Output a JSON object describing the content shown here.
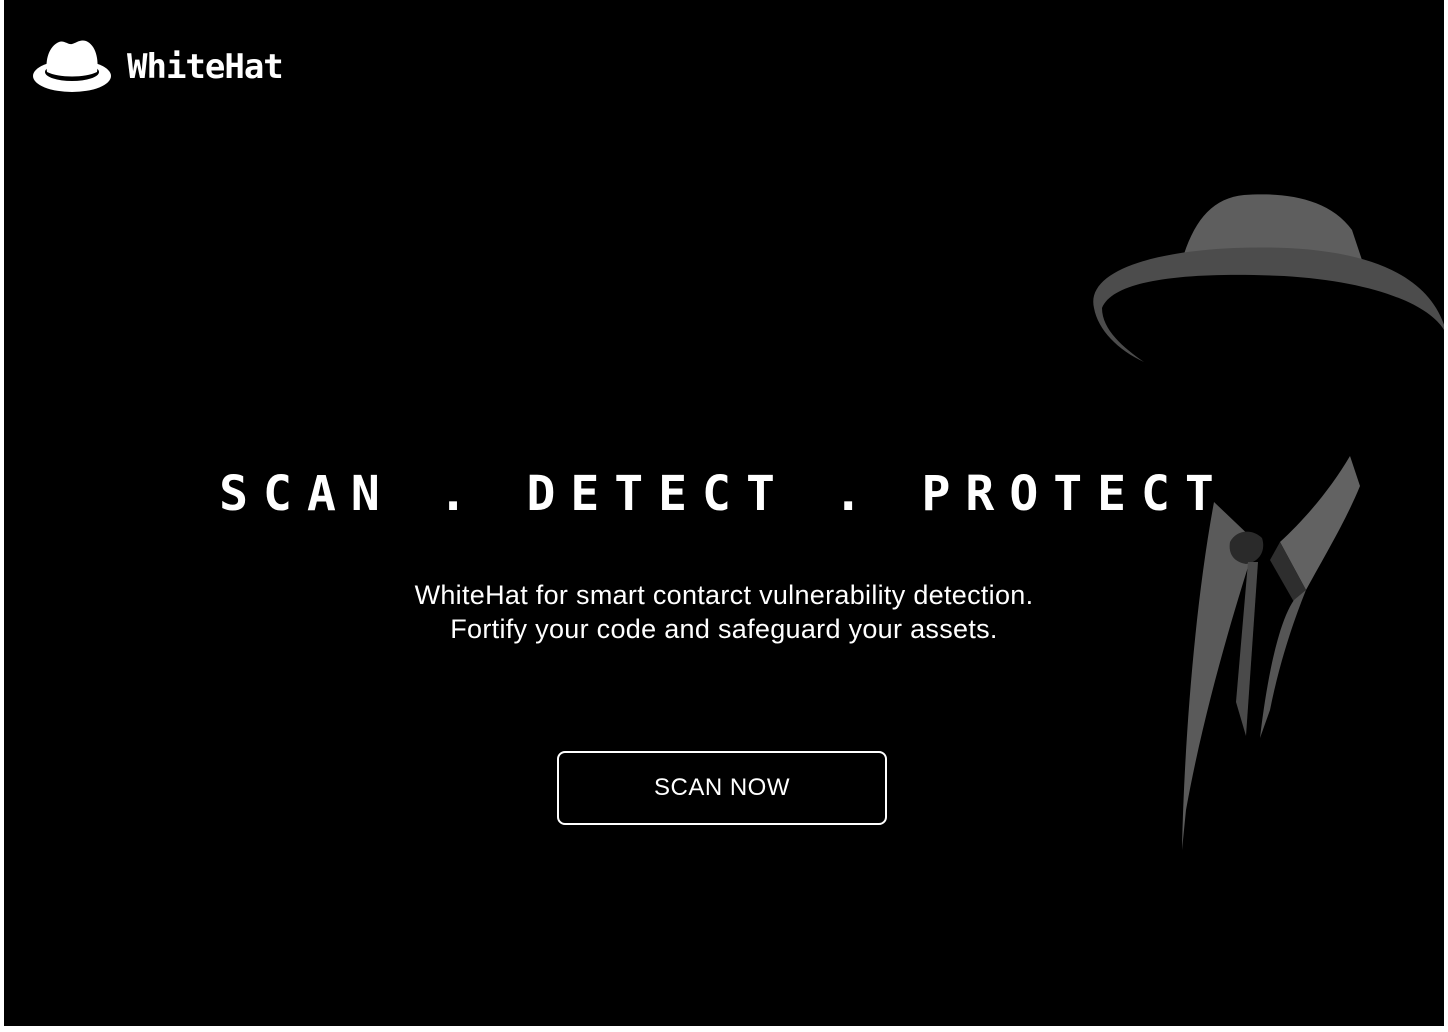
{
  "header": {
    "brand_name": "WhiteHat",
    "logo_icon": "fedora-hat-icon"
  },
  "hero": {
    "headline": "SCAN . DETECT . PROTECT",
    "subtitle_line1": "WhiteHat for smart contarct vulnerability detection.",
    "subtitle_line2": "Fortify your code and safeguard your assets.",
    "cta_label": "SCAN NOW",
    "illustration": "man-in-hat-silhouette"
  },
  "colors": {
    "background": "#000000",
    "text": "#ffffff",
    "accent_gray": "#6b6b6b"
  }
}
